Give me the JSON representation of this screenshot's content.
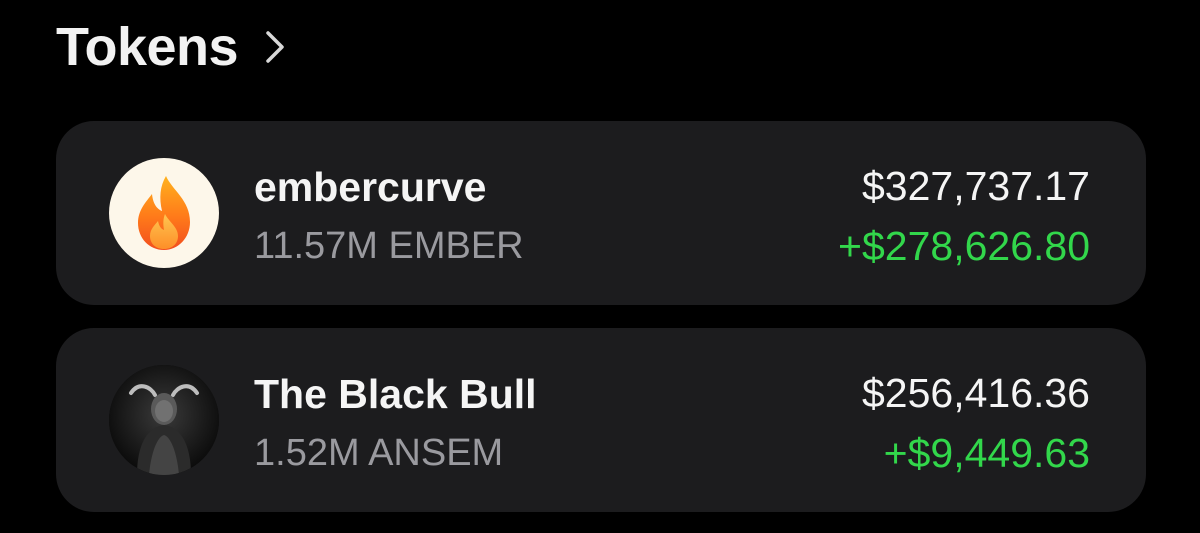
{
  "header": {
    "title": "Tokens",
    "chevron_icon": "chevron-right-icon"
  },
  "colors": {
    "background": "#000000",
    "card": "#1c1c1e",
    "primary_text": "#f5f5f5",
    "secondary_text": "#9a9a9f",
    "positive": "#32d74b"
  },
  "tokens": [
    {
      "name": "embercurve",
      "amount": "11.57M EMBER",
      "value": "$327,737.17",
      "change": "+$278,626.80",
      "icon": "flame-icon"
    },
    {
      "name": "The Black Bull",
      "amount": "1.52M ANSEM",
      "value": "$256,416.36",
      "change": "+$9,449.63",
      "icon": "black-bull-avatar"
    }
  ]
}
